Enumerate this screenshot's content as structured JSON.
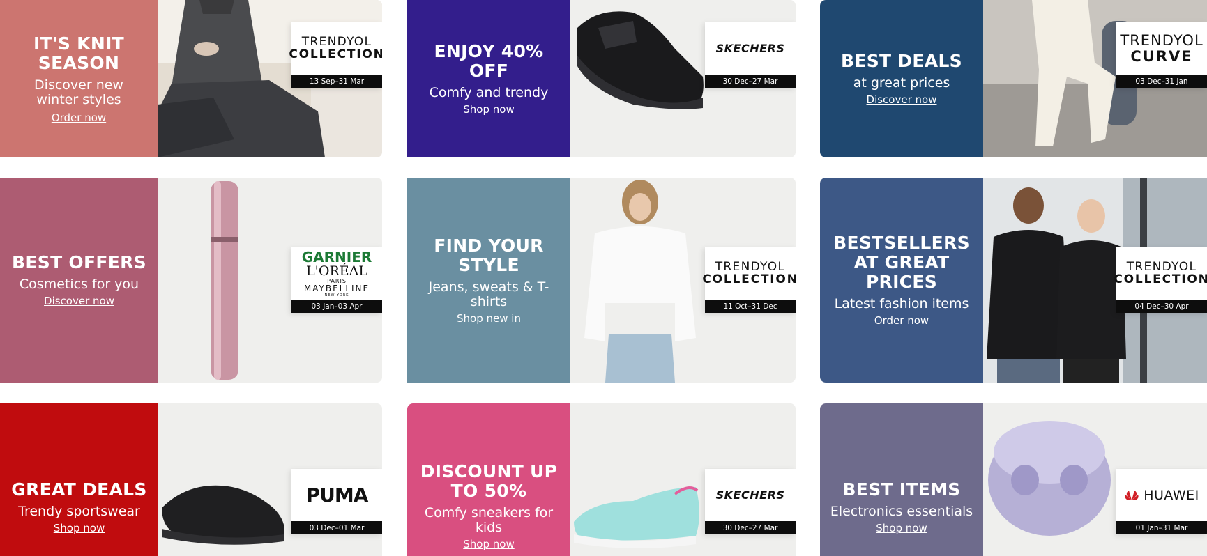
{
  "banners": [
    {
      "headline": "IT'S KNIT SEASON",
      "sub": "Discover new winter styles",
      "cta": "Order now",
      "brand": {
        "l1": "TRENDYOL",
        "l2": "COLLECTION"
      },
      "dates": "13 Sep–31 Mar",
      "color": "#cc7570",
      "photo": "knitwear-model-photo"
    },
    {
      "headline": "ENJOY 40% OFF",
      "sub": "Comfy and trendy",
      "cta": "Shop now",
      "brand": {
        "logo": "SKECHERS"
      },
      "dates": "30 Dec–27 Mar",
      "color": "#331e8c",
      "photo": "black-sneaker-photo"
    },
    {
      "headline": "BEST DEALS",
      "sub": "at great prices",
      "cta": "Discover now",
      "brand": {
        "l1": "TRENDYOL",
        "l2": "CURVE"
      },
      "dates": "03 Dec–31 Jan",
      "color": "#1f4870",
      "photo": "cream-outfit-model-photo"
    },
    {
      "headline": "BEST OFFERS",
      "sub": "Cosmetics for you",
      "cta": "Discover now",
      "brand": {
        "garnier": "GARNIER",
        "loreal": "L'ORÉAL",
        "paris": "PARIS",
        "maybelline": "MAYBELLINE",
        "newyork": "NEW YORK"
      },
      "dates": "03 Jan–03 Apr",
      "color": "#ad5c72",
      "photo": "mascara-photo"
    },
    {
      "headline": "FIND YOUR STYLE",
      "sub": "Jeans, sweats & T-shirts",
      "cta": "Shop new in",
      "brand": {
        "l1": "TRENDYOL",
        "l2": "COLLECTION"
      },
      "dates": "11 Oct–31 Dec",
      "color": "#6a8fa1",
      "photo": "white-sweatshirt-model-photo"
    },
    {
      "headline": "BESTSELLERS AT GREAT PRICES",
      "sub": "Latest fashion items",
      "cta": "Order now",
      "brand": {
        "l1": "TRENDYOL",
        "l2": "COLLECTION"
      },
      "dates": "04 Dec–30 Apr",
      "color": "#3d5886",
      "photo": "hoodie-couple-photo"
    },
    {
      "headline": "GREAT DEALS",
      "sub": "Trendy sportswear",
      "cta": "Shop now",
      "brand": {
        "logo": "PUMA"
      },
      "dates": "03 Dec–01 Mar",
      "color": "#c00c0e",
      "photo": "puma-sneaker-photo"
    },
    {
      "headline": "DISCOUNT UP TO 50%",
      "sub": "Comfy sneakers for kids",
      "cta": "Shop now",
      "brand": {
        "logo": "SKECHERS"
      },
      "dates": "30 Dec–27 Mar",
      "color": "#d94f80",
      "photo": "kids-sneaker-photo"
    },
    {
      "headline": "BEST ITEMS",
      "sub": "Electronics essentials",
      "cta": "Shop now",
      "brand": {
        "logo": "HUAWEI"
      },
      "dates": "01 Jan–31 Mar",
      "color": "#6e6b8c",
      "photo": "earbuds-photo"
    }
  ]
}
